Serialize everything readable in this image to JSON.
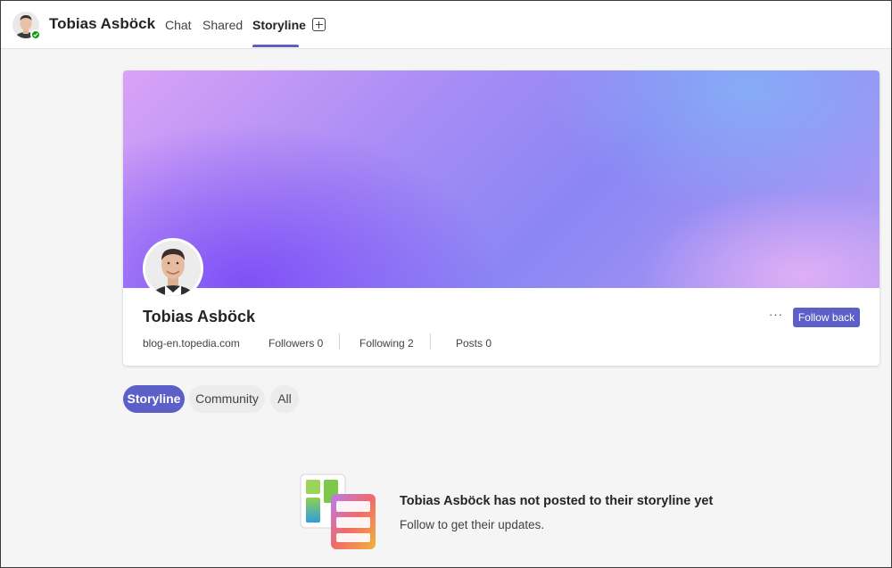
{
  "header": {
    "user_name": "Tobias Asböck",
    "tabs": [
      {
        "label": "Chat"
      },
      {
        "label": "Shared"
      },
      {
        "label": "Storyline"
      }
    ],
    "active_tab": "Storyline",
    "presence": "available"
  },
  "profile": {
    "name": "Tobias Asböck",
    "website": "blog-en.topedia.com",
    "followers": "Followers 0",
    "following": "Following 2",
    "posts": "Posts 0",
    "more_label": "···",
    "follow_back_label": "Follow back"
  },
  "filters": {
    "items": [
      {
        "label": "Storyline"
      },
      {
        "label": "Community"
      },
      {
        "label": "All"
      }
    ],
    "active": "Storyline"
  },
  "empty_state": {
    "title": "Tobias Asböck has not posted to their storyline yet",
    "subtitle": "Follow to get their updates."
  },
  "colors": {
    "accent": "#5b5fc7",
    "presence_green": "#13a10e"
  }
}
